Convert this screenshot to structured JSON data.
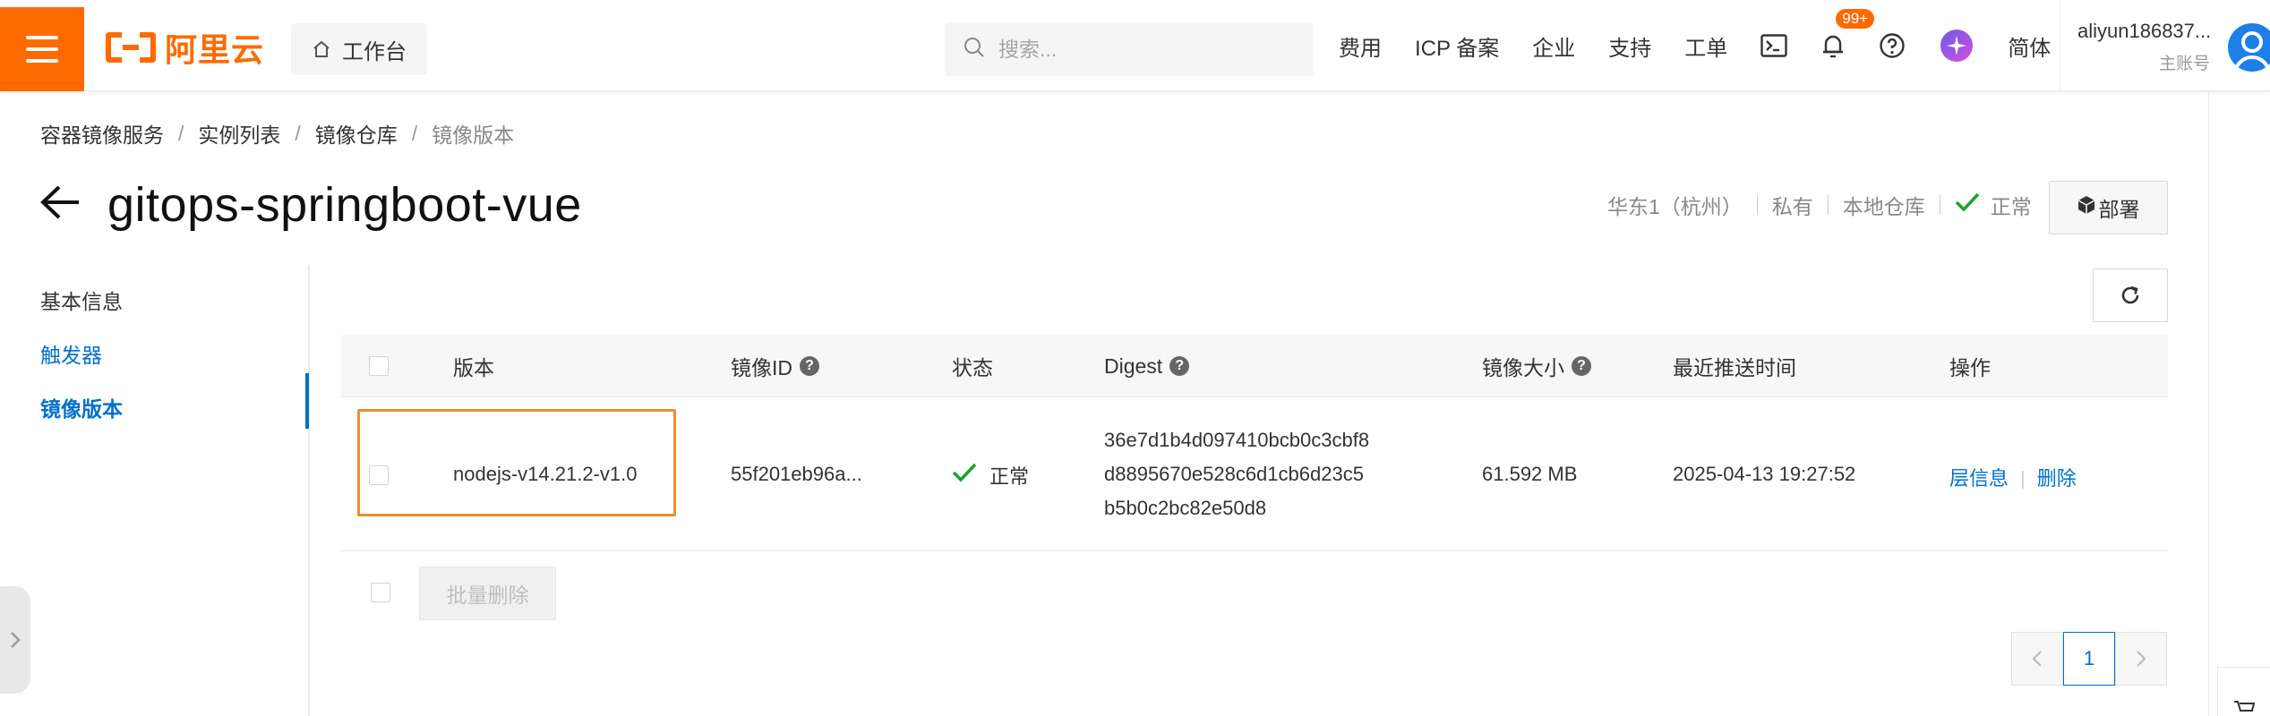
{
  "topbar": {
    "logo_text": "阿里云",
    "workbench_label": "工作台",
    "search_placeholder": "搜索...",
    "nav_links": [
      "费用",
      "ICP 备案",
      "企业",
      "支持",
      "工单"
    ],
    "notification_count": "99+",
    "language": "简体",
    "user_name": "aliyun186837...",
    "user_role": "主账号",
    "brand_color": "#ff6a00"
  },
  "breadcrumb": [
    "容器镜像服务",
    "实例列表",
    "镜像仓库",
    "镜像版本"
  ],
  "repo": {
    "name": "gitops-springboot-vue",
    "region": "华东1（杭州）",
    "visibility": "私有",
    "source": "本地仓库",
    "status": "正常",
    "deploy_label": "部署"
  },
  "sidenav": {
    "items": [
      "基本信息",
      "触发器",
      "镜像版本"
    ],
    "active": "镜像版本"
  },
  "table": {
    "columns": [
      "版本",
      "镜像ID",
      "状态",
      "Digest",
      "镜像大小",
      "最近推送时间",
      "操作"
    ],
    "rows": [
      {
        "version": "nodejs-v14.21.2-v1.0",
        "image_id": "55f201eb96a...",
        "status": "正常",
        "digest": [
          "36e7d1b4d097410bcb0c3cbf8",
          "d8895670e528c6d1cb6d23c5",
          "b5b0c2bc82e50d8"
        ],
        "size": "61.592 MB",
        "pushed_at": "2025-04-13 19:27:52",
        "actions": [
          "层信息",
          "删除"
        ]
      }
    ]
  },
  "batch_delete_label": "批量删除",
  "pagination": {
    "current_page": "1"
  },
  "colors": {
    "link": "#0070cc",
    "success": "#1aa32f",
    "highlight": "#f08c2a"
  }
}
